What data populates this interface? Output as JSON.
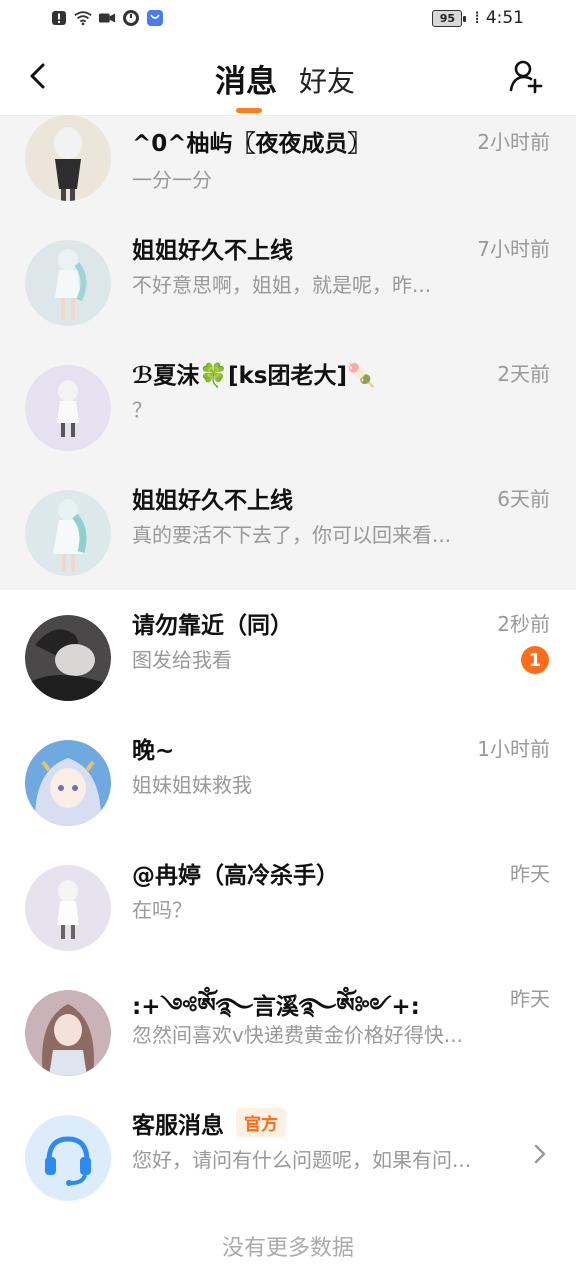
{
  "status_bar": {
    "battery": "95",
    "time": "4:51",
    "icons": [
      "alert-icon",
      "wifi-icon",
      "video-icon",
      "timer-icon",
      "app-icon"
    ]
  },
  "nav": {
    "back_icon": "back-icon",
    "tab_messages": "消息",
    "tab_friends": "好友",
    "add_friend_icon": "add-user-icon",
    "accent_color": "#ff7d1c"
  },
  "conversations": [
    {
      "name": "^0^柚屿〖夜夜成员〗",
      "preview": "一分一分",
      "time": "2小时前",
      "pinned": true
    },
    {
      "name": "姐姐好久不上线",
      "preview": "不好意思啊，姐姐，就是呢，昨...",
      "time": "7小时前",
      "pinned": true
    },
    {
      "name": "ℬ夏沫🍀[ks团老大]🍡",
      "preview": "？",
      "time": "2天前",
      "pinned": true
    },
    {
      "name": "姐姐好久不上线",
      "preview": "真的要活不下去了，你可以回来看...",
      "time": "6天前",
      "pinned": true
    },
    {
      "name": "请勿靠近（同）",
      "preview": "图发给我看",
      "time": "2秒前",
      "unread": "1",
      "pinned": false
    },
    {
      "name": "晚~",
      "preview": "姐妹姐妹救我",
      "time": "1小时前",
      "pinned": false
    },
    {
      "name": "@冉婷（高冷杀手）",
      "preview": "在吗？",
      "time": "昨天",
      "pinned": false
    },
    {
      "name": ":+༺ༀ࿐言溪࿐ༀ༻+:",
      "preview": "忽然间喜欢v快递费黄金价格好得快...",
      "time": "昨天",
      "pinned": false
    },
    {
      "name": "客服消息",
      "tag": "官方",
      "preview": "您好，请问有什么问题呢，如果有问...",
      "pinned": false
    }
  ],
  "footer": "没有更多数据"
}
